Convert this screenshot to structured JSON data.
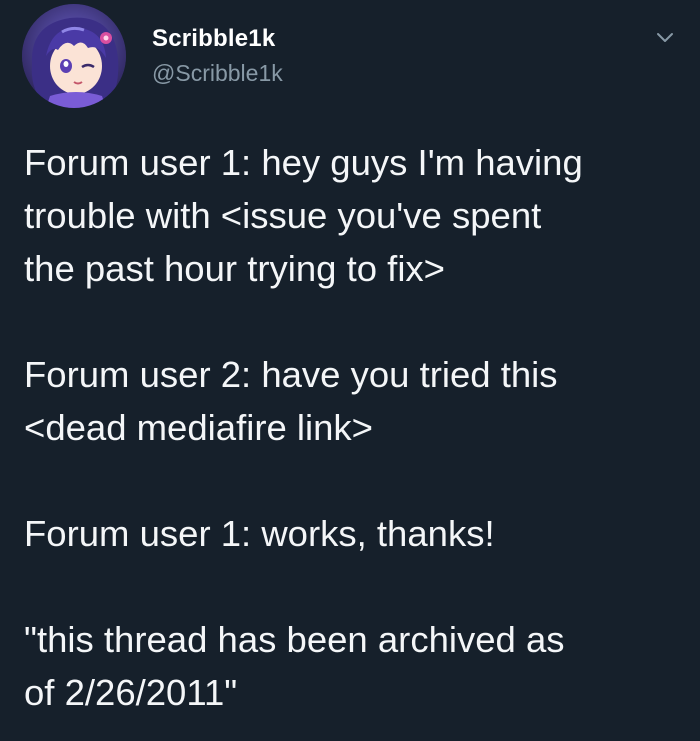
{
  "tweet": {
    "display_name": "Scribble1k",
    "handle": "@Scribble1k",
    "avatar_icon": "anime-character-avatar",
    "menu_icon": "chevron-down-icon",
    "paragraphs": [
      "Forum user 1: hey guys I'm having\ntrouble with <issue you've spent\nthe past hour trying to fix>",
      "Forum user 2: have you tried this\n<dead mediafire link>",
      "Forum user 1: works,  thanks!",
      "\"this thread has been archived as\nof 2/26/2011\""
    ]
  },
  "colors": {
    "background": "#16202b",
    "text": "#f4f6f8",
    "handle": "#8899a6",
    "chevron": "#8899a6"
  }
}
